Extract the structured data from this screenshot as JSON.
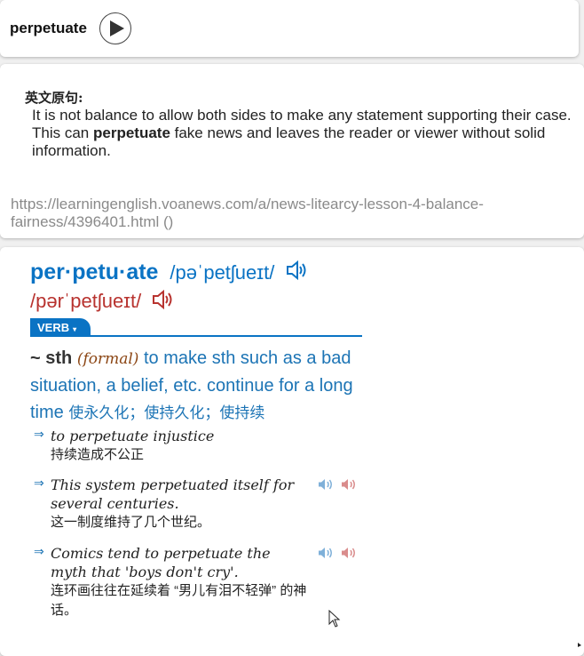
{
  "word_card": {
    "word": "perpetuate",
    "play_icon": "play-icon"
  },
  "example_card": {
    "label": "英文原句:",
    "sentence_before": "It is not balance to allow both sides to make any statement supporting their case. This can ",
    "sentence_keyword": "perpetuate",
    "sentence_after": " fake news and leaves the reader or viewer without solid information.",
    "source": "https://learningenglish.voanews.com/a/news-litearcy-lesson-4-balance-fairness/4396401.html ()"
  },
  "dictionary": {
    "headword": "per·petu·ate",
    "pron_br": "/pəˈpetʃueɪt/",
    "pron_us": "/pərˈpetʃueɪt/",
    "speaker_icon": "speaker-icon",
    "pos": "VERB",
    "pos_caret": "▾",
    "sense": {
      "pattern": "~ sth",
      "label": "(formal)",
      "definition": " to make sth such as a bad situation, a belief, etc. continue for a long time ",
      "definition_zh": "使永久化；使持久化；使持续"
    },
    "examples": [
      {
        "en": "to perpetuate injustice",
        "zh": "持续造成不公正",
        "has_audio": false
      },
      {
        "en": "This system perpetuated itself for several centuries.",
        "zh": "这一制度维持了几个世纪。",
        "has_audio": true
      },
      {
        "en": "Comics tend to perpetuate the myth that 'boys don't cry'.",
        "zh": "连环画往往在延续着 “男儿有泪不轻弹” 的神话。",
        "has_audio": true
      }
    ],
    "example_arrow": "⇒"
  },
  "colors": {
    "brand_blue": "#0a73c4",
    "us_red": "#b8332f",
    "source_gray": "#8a8a8a"
  }
}
